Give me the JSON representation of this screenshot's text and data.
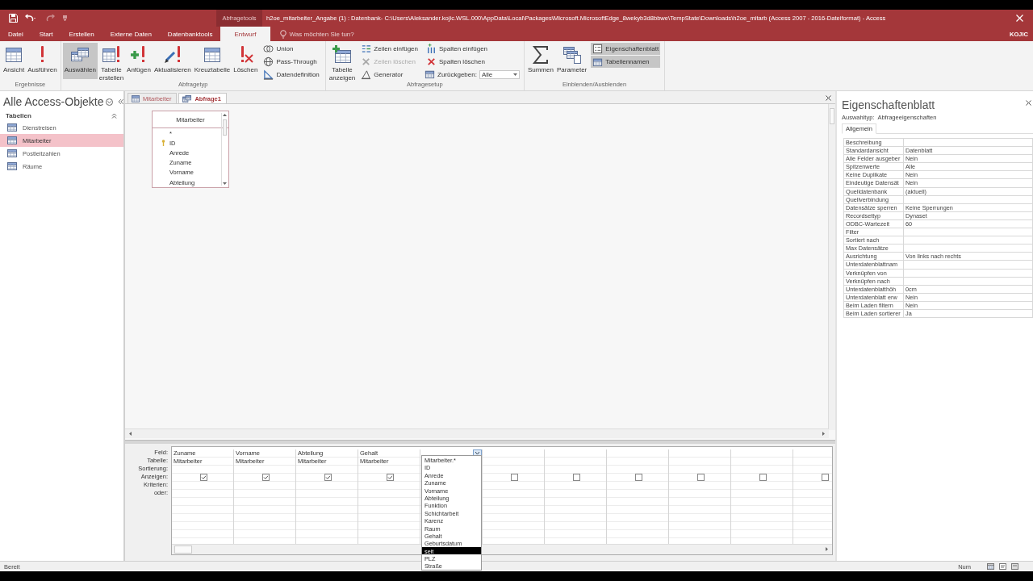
{
  "window": {
    "context_label": "Abfragetools",
    "title": "h2oe_mitarbeiter_Angabe (1) : Datenbank- C:\\Users\\Aleksander.kojic.WSL.000\\AppData\\Local\\Packages\\Microsoft.MicrosoftEdge_8wekyb3d8bbwe\\TempState\\Downloads\\h2oe_mitarb (Access 2007 - 2016-Dateiformat) - Access",
    "user": "KOJIC"
  },
  "ribbon_tabs": [
    {
      "label": "Datei",
      "selected": false
    },
    {
      "label": "Start",
      "selected": false
    },
    {
      "label": "Erstellen",
      "selected": false
    },
    {
      "label": "Externe Daten",
      "selected": false
    },
    {
      "label": "Datenbanktools",
      "selected": false
    },
    {
      "label": "Entwurf",
      "selected": true
    }
  ],
  "tell_me": "Was möchten Sie tun?",
  "ribbon_groups": [
    {
      "label": "Ergebnisse",
      "commands": [
        {
          "label": "Ansicht",
          "kind": "large",
          "pressed": false,
          "disabled": false
        },
        {
          "label": "Ausführen",
          "kind": "large",
          "pressed": false,
          "disabled": false
        }
      ]
    },
    {
      "label": "Abfragetyp",
      "commands": [
        {
          "label": "Auswählen",
          "kind": "large",
          "pressed": true,
          "disabled": false
        },
        {
          "label": "Tabelle erstellen",
          "kind": "large",
          "pressed": false,
          "disabled": false
        },
        {
          "label": "Anfügen",
          "kind": "large",
          "pressed": false,
          "disabled": false
        },
        {
          "label": "Aktualisieren",
          "kind": "large",
          "pressed": false,
          "disabled": false
        },
        {
          "label": "Kreuztabelle",
          "kind": "large",
          "pressed": false,
          "disabled": false
        },
        {
          "label": "Löschen",
          "kind": "large",
          "pressed": false,
          "disabled": false
        },
        {
          "label": "Union",
          "kind": "small",
          "pressed": false,
          "disabled": false
        },
        {
          "label": "Pass-Through",
          "kind": "small",
          "pressed": false,
          "disabled": false
        },
        {
          "label": "Datendefinition",
          "kind": "small",
          "pressed": false,
          "disabled": false
        }
      ]
    },
    {
      "label": "Abfragesetup",
      "commands": [
        {
          "label": "Tabelle anzeigen",
          "kind": "large",
          "pressed": false,
          "disabled": false
        },
        {
          "label": "Zeilen einfügen",
          "kind": "small",
          "pressed": false,
          "disabled": false
        },
        {
          "label": "Zeilen löschen",
          "kind": "small",
          "pressed": false,
          "disabled": true
        },
        {
          "label": "Generator",
          "kind": "small",
          "pressed": false,
          "disabled": false
        },
        {
          "label": "Spalten einfügen",
          "kind": "small",
          "pressed": false,
          "disabled": false
        },
        {
          "label": "Spalten löschen",
          "kind": "small",
          "pressed": false,
          "disabled": false
        },
        {
          "label": "Zurückgeben:",
          "kind": "combo",
          "pressed": false,
          "disabled": false,
          "value": "Alle"
        }
      ]
    },
    {
      "label": "Einblenden/Ausblenden",
      "commands": [
        {
          "label": "Summen",
          "kind": "large",
          "pressed": false,
          "disabled": false
        },
        {
          "label": "Parameter",
          "kind": "large",
          "pressed": false,
          "disabled": false
        },
        {
          "label": "Eigenschaftenblatt",
          "kind": "small",
          "pressed": true,
          "disabled": false
        },
        {
          "label": "Tabellennamen",
          "kind": "small",
          "pressed": true,
          "disabled": false
        }
      ]
    }
  ],
  "navigation": {
    "title": "Alle Access-Objekte",
    "section": "Tabellen",
    "items": [
      {
        "label": "Dienstreisen",
        "selected": false
      },
      {
        "label": "Mitarbeiter",
        "selected": true
      },
      {
        "label": "Postleitzahlen",
        "selected": false
      },
      {
        "label": "Räume",
        "selected": false
      }
    ]
  },
  "document_tabs": [
    {
      "label": "Mitarbeiter",
      "kind": "table",
      "selected": false
    },
    {
      "label": "Abfrage1",
      "kind": "query",
      "selected": true
    }
  ],
  "design_table": {
    "title": "Mitarbeiter",
    "fields": [
      {
        "name": "*",
        "key": false
      },
      {
        "name": "ID",
        "key": true
      },
      {
        "name": "Anrede",
        "key": false
      },
      {
        "name": "Zuname",
        "key": false
      },
      {
        "name": "Vorname",
        "key": false
      },
      {
        "name": "Abteilung",
        "key": false
      }
    ]
  },
  "grid": {
    "row_labels": [
      "Feld:",
      "Tabelle:",
      "Sortierung:",
      "Anzeigen:",
      "Kriterien:",
      "oder:"
    ],
    "columns": [
      {
        "field": "Zuname",
        "table": "Mitarbeiter",
        "show": true,
        "dropdown_open": false
      },
      {
        "field": "Vorname",
        "table": "Mitarbeiter",
        "show": true,
        "dropdown_open": false
      },
      {
        "field": "Abteilung",
        "table": "Mitarbeiter",
        "show": true,
        "dropdown_open": false
      },
      {
        "field": "Gehalt",
        "table": "Mitarbeiter",
        "show": true,
        "dropdown_open": false
      },
      {
        "dropdown_open": true
      },
      {
        "show": false,
        "dropdown_open": false
      },
      {
        "show": false,
        "dropdown_open": false
      },
      {
        "show": false,
        "dropdown_open": false
      },
      {
        "show": false,
        "dropdown_open": false
      },
      {
        "show": false,
        "dropdown_open": false
      },
      {
        "show": false,
        "dropdown_open": false
      }
    ],
    "dropdown": {
      "items": [
        {
          "label": "Mitarbeiter.*",
          "selected": false
        },
        {
          "label": "ID",
          "selected": false
        },
        {
          "label": "Anrede",
          "selected": false
        },
        {
          "label": "Zuname",
          "selected": false
        },
        {
          "label": "Vorname",
          "selected": false
        },
        {
          "label": "Abteilung",
          "selected": false
        },
        {
          "label": "Funktion",
          "selected": false
        },
        {
          "label": "Schichtarbeit",
          "selected": false
        },
        {
          "label": "Karenz",
          "selected": false
        },
        {
          "label": "Raum",
          "selected": false
        },
        {
          "label": "Gehalt",
          "selected": false
        },
        {
          "label": "Geburtsdatum",
          "selected": false
        },
        {
          "label": "seit",
          "selected": true
        },
        {
          "label": "PLZ",
          "selected": false
        },
        {
          "label": "Straße",
          "selected": false
        }
      ]
    }
  },
  "property_sheet": {
    "title": "Eigenschaftenblatt",
    "selection_label": "Auswahltyp:",
    "selection_type": "Abfrageeigenschaften",
    "tab": "Allgemein",
    "rows": [
      {
        "name": "Beschreibung"
      },
      {
        "name": "Standardansicht",
        "value": "Datenblatt"
      },
      {
        "name": "Alle Felder ausgeber",
        "value": "Nein"
      },
      {
        "name": "Spitzenwerte",
        "value": "Alle"
      },
      {
        "name": "Keine Duplikate",
        "value": "Nein"
      },
      {
        "name": "Eindeutige Datensät",
        "value": "Nein"
      },
      {
        "name": "Quelldatenbank",
        "value": "(aktuell)"
      },
      {
        "name": "Quellverbindung"
      },
      {
        "name": "Datensätze sperren",
        "value": "Keine Sperrungen"
      },
      {
        "name": "Recordsettyp",
        "value": "Dynaset"
      },
      {
        "name": "ODBC-Wartezeit",
        "value": "60"
      },
      {
        "name": "Filter"
      },
      {
        "name": "Sortiert nach"
      },
      {
        "name": "Max Datensätze"
      },
      {
        "name": "Ausrichtung",
        "value": "Von links nach rechts"
      },
      {
        "name": "Unterdatenblattnam"
      },
      {
        "name": "Verknüpfen von"
      },
      {
        "name": "Verknüpfen nach"
      },
      {
        "name": "Unterdatenblatthöh",
        "value": "0cm"
      },
      {
        "name": "Unterdatenblatt erw",
        "value": "Nein"
      },
      {
        "name": "Beim Laden filtern",
        "value": "Nein"
      },
      {
        "name": "Beim Laden sortierer",
        "value": "Ja"
      }
    ]
  },
  "status_bar": {
    "text": "Bereit",
    "indicator": "Num"
  }
}
